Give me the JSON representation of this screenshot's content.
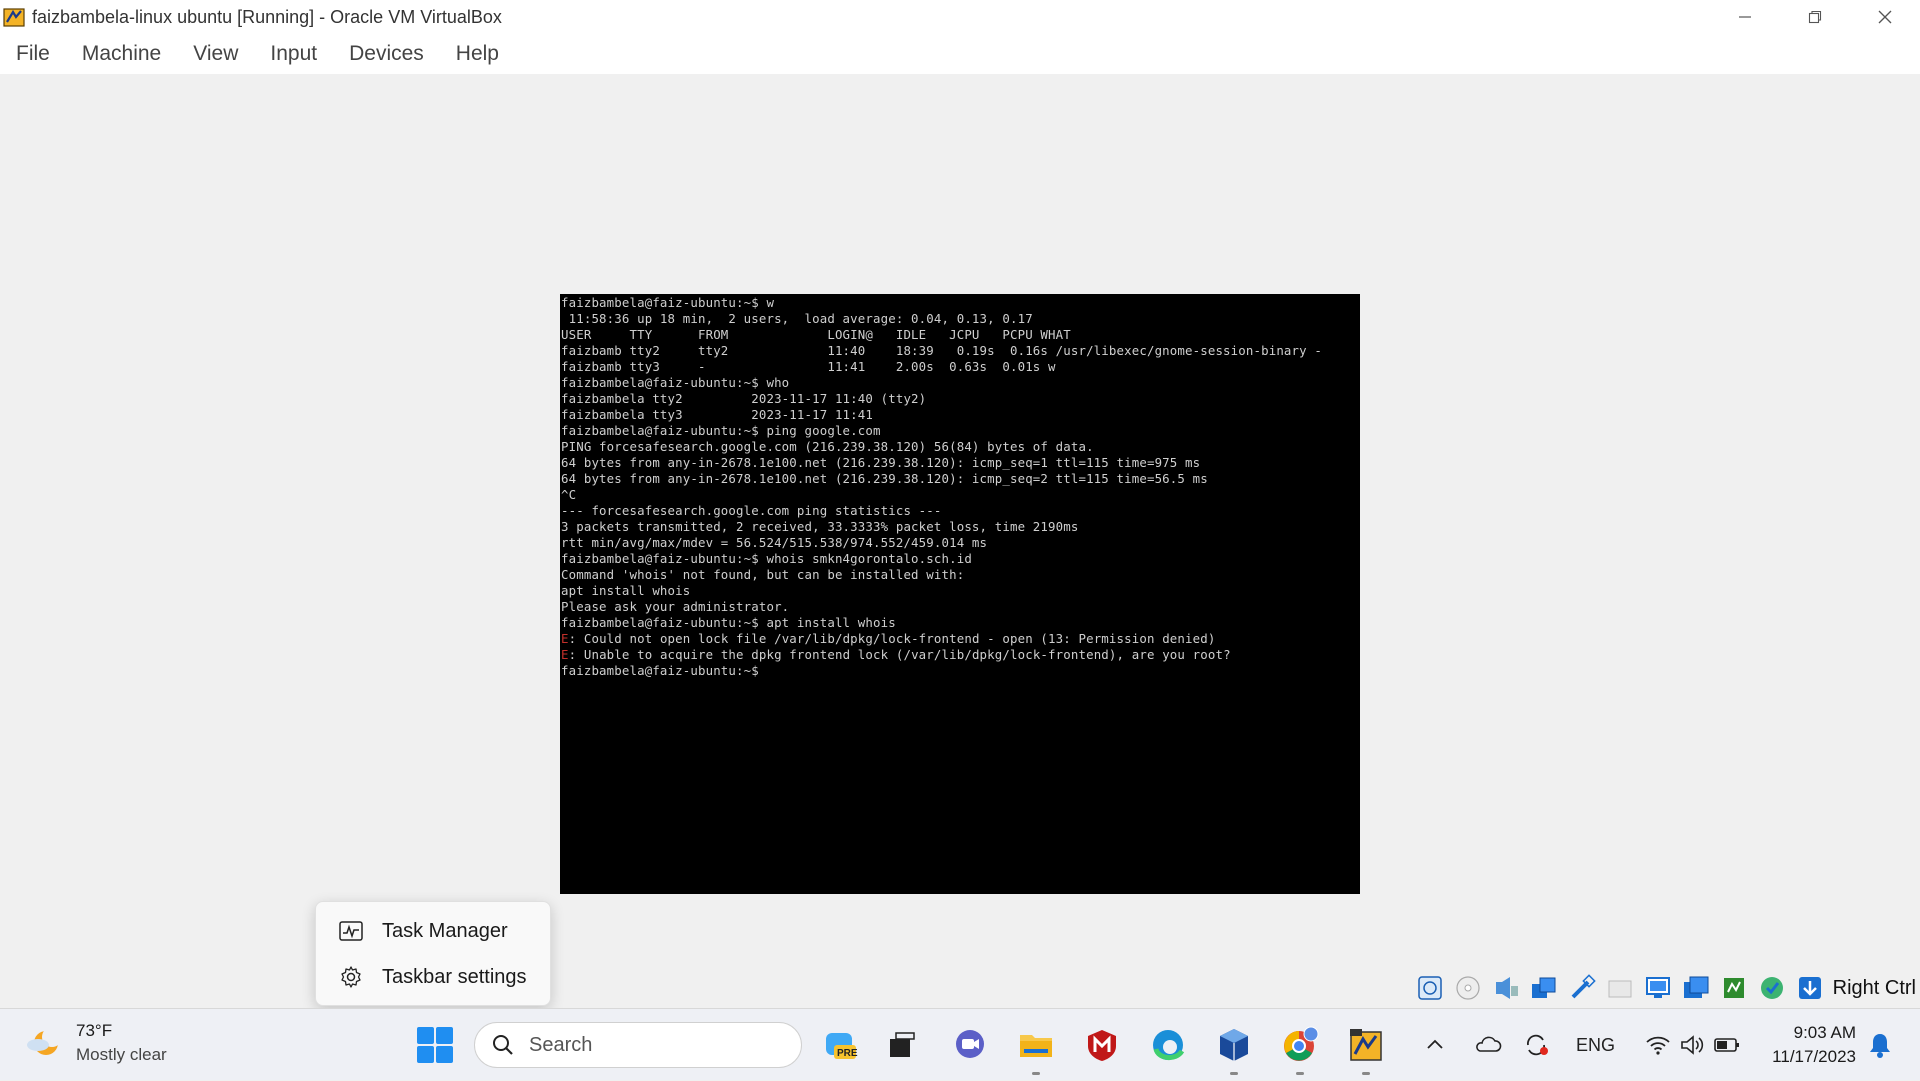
{
  "window": {
    "title": "faizbambela-linux ubuntu [Running] - Oracle VM VirtualBox"
  },
  "menu": [
    "File",
    "Machine",
    "View",
    "Input",
    "Devices",
    "Help"
  ],
  "terminal": {
    "lines": [
      {
        "text": "faizbambela@faiz-ubuntu:~$ w",
        "err": false
      },
      {
        "text": " 11:58:36 up 18 min,  2 users,  load average: 0.04, 0.13, 0.17",
        "err": false
      },
      {
        "text": "USER     TTY      FROM             LOGIN@   IDLE   JCPU   PCPU WHAT",
        "err": false
      },
      {
        "text": "faizbamb tty2     tty2             11:40    18:39   0.19s  0.16s /usr/libexec/gnome-session-binary -",
        "err": false
      },
      {
        "text": "faizbamb tty3     -                11:41    2.00s  0.63s  0.01s w",
        "err": false
      },
      {
        "text": "faizbambela@faiz-ubuntu:~$ who",
        "err": false
      },
      {
        "text": "faizbambela tty2         2023-11-17 11:40 (tty2)",
        "err": false
      },
      {
        "text": "faizbambela tty3         2023-11-17 11:41",
        "err": false
      },
      {
        "text": "faizbambela@faiz-ubuntu:~$ ping google.com",
        "err": false
      },
      {
        "text": "PING forcesafesearch.google.com (216.239.38.120) 56(84) bytes of data.",
        "err": false
      },
      {
        "text": "64 bytes from any-in-2678.1e100.net (216.239.38.120): icmp_seq=1 ttl=115 time=975 ms",
        "err": false
      },
      {
        "text": "64 bytes from any-in-2678.1e100.net (216.239.38.120): icmp_seq=2 ttl=115 time=56.5 ms",
        "err": false
      },
      {
        "text": "^C",
        "err": false
      },
      {
        "text": "--- forcesafesearch.google.com ping statistics ---",
        "err": false
      },
      {
        "text": "3 packets transmitted, 2 received, 33.3333% packet loss, time 2190ms",
        "err": false
      },
      {
        "text": "rtt min/avg/max/mdev = 56.524/515.538/974.552/459.014 ms",
        "err": false
      },
      {
        "text": "faizbambela@faiz-ubuntu:~$ whois smkn4gorontalo.sch.id",
        "err": false
      },
      {
        "text": "Command 'whois' not found, but can be installed with:",
        "err": false
      },
      {
        "text": "apt install whois",
        "err": false
      },
      {
        "text": "Please ask your administrator.",
        "err": false
      },
      {
        "text": "faizbambela@faiz-ubuntu:~$ apt install whois",
        "err": false
      },
      {
        "prefix": "E",
        "text": ": Could not open lock file /var/lib/dpkg/lock-frontend - open (13: Permission denied)",
        "err": true
      },
      {
        "prefix": "E",
        "text": ": Unable to acquire the dpkg frontend lock (/var/lib/dpkg/lock-frontend), are you root?",
        "err": true
      },
      {
        "text": "faizbambela@faiz-ubuntu:~$",
        "err": false
      }
    ]
  },
  "context_menu": {
    "task_manager": "Task Manager",
    "taskbar_settings": "Taskbar settings"
  },
  "statusbar": {
    "host_key": "Right Ctrl"
  },
  "taskbar": {
    "weather_temp": "73°F",
    "weather_desc": "Mostly clear",
    "search_label": "Search",
    "lang": "ENG",
    "time": "9:03 AM",
    "date": "11/17/2023"
  },
  "colors": {
    "terminal_bg": "#000000",
    "terminal_fg": "#cfcfcf",
    "error_red": "#c4302b",
    "accent": "#1f8ef1"
  }
}
